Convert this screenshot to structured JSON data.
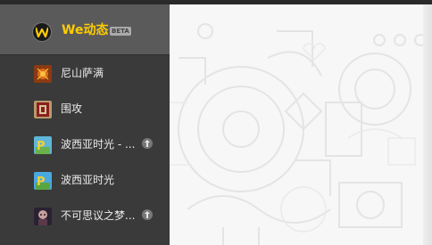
{
  "brand": {
    "name": "We动态",
    "beta": "BETA",
    "logo_icon": "w-logo-icon"
  },
  "games": [
    {
      "label": "尼山萨满",
      "icon": "nishan-sama-icon",
      "pinned": false
    },
    {
      "label": "围攻",
      "icon": "besiege-icon",
      "pinned": false
    },
    {
      "label": "波西亚时光 - ...",
      "icon": "portia-icon",
      "pinned": true
    },
    {
      "label": "波西亚时光",
      "icon": "portia-icon",
      "pinned": false
    },
    {
      "label": "不可思议之梦...",
      "icon": "dream-icon",
      "pinned": true
    }
  ],
  "colors": {
    "brand_accent": "#ffcc00",
    "sidebar_bg": "#3a3a3a",
    "header_bg": "#5a5a5a",
    "content_bg": "#f7f7f7"
  }
}
